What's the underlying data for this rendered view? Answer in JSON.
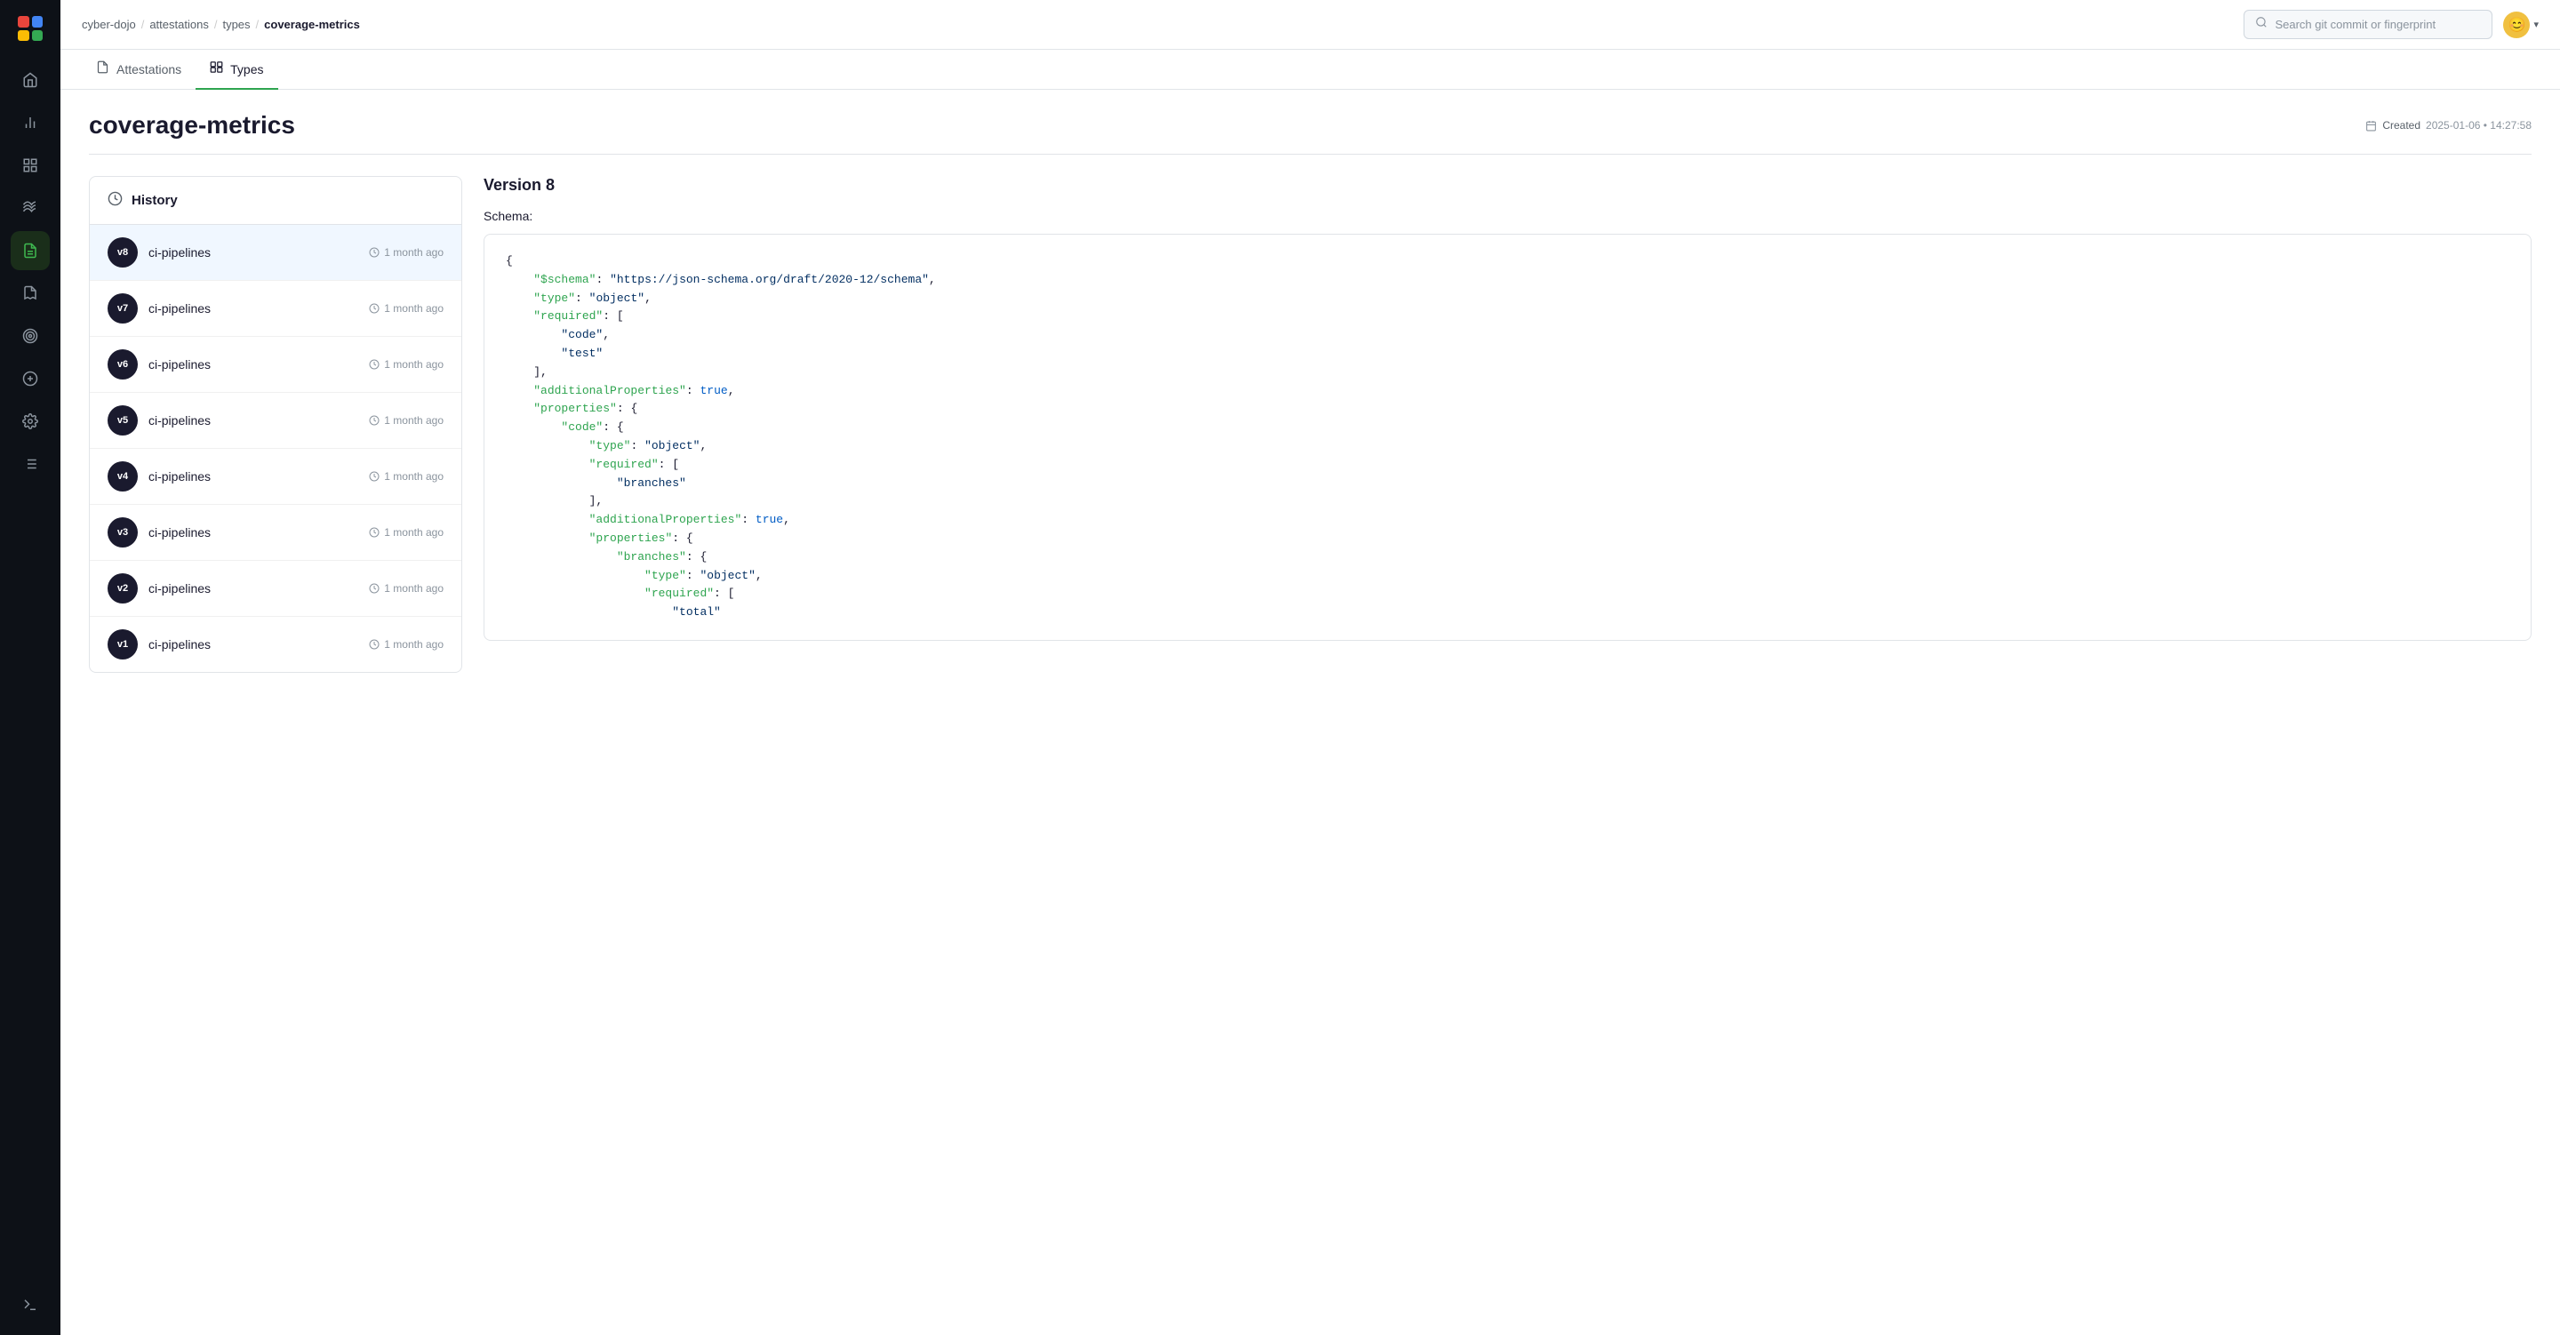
{
  "sidebar": {
    "logo_colors": [
      "red",
      "blue",
      "yellow",
      "green"
    ],
    "items": [
      {
        "name": "home",
        "icon": "⌂",
        "active": false
      },
      {
        "name": "chart-bar",
        "icon": "▦",
        "active": false
      },
      {
        "name": "grid",
        "icon": "⊞",
        "active": false
      },
      {
        "name": "waves",
        "icon": "≋",
        "active": false
      },
      {
        "name": "document",
        "icon": "📄",
        "active": true
      },
      {
        "name": "receipt",
        "icon": "🧾",
        "active": false
      },
      {
        "name": "target",
        "icon": "◎",
        "active": false
      },
      {
        "name": "plus-circle",
        "icon": "⊕",
        "active": false
      },
      {
        "name": "settings",
        "icon": "⚙",
        "active": false
      },
      {
        "name": "list",
        "icon": "☰",
        "active": false
      },
      {
        "name": "terminal",
        "icon": "›_",
        "active": false
      }
    ]
  },
  "header": {
    "breadcrumb": {
      "parts": [
        "cyber-dojo",
        "attestations",
        "types"
      ],
      "current": "coverage-metrics",
      "separator": "/"
    },
    "search": {
      "placeholder": "Search git commit or fingerprint"
    },
    "avatar": "😊"
  },
  "tabs": [
    {
      "label": "Attestations",
      "icon": "📋",
      "active": false
    },
    {
      "label": "Types",
      "icon": "🗂",
      "active": true
    }
  ],
  "page": {
    "title": "coverage-metrics",
    "created_label": "Created",
    "created_date": "2025-01-06 • 14:27:58"
  },
  "history": {
    "title": "History",
    "items": [
      {
        "version": "v8",
        "name": "ci-pipelines",
        "time": "1 month ago",
        "active": true
      },
      {
        "version": "v7",
        "name": "ci-pipelines",
        "time": "1 month ago",
        "active": false
      },
      {
        "version": "v6",
        "name": "ci-pipelines",
        "time": "1 month ago",
        "active": false
      },
      {
        "version": "v5",
        "name": "ci-pipelines",
        "time": "1 month ago",
        "active": false
      },
      {
        "version": "v4",
        "name": "ci-pipelines",
        "time": "1 month ago",
        "active": false
      },
      {
        "version": "v3",
        "name": "ci-pipelines",
        "time": "1 month ago",
        "active": false
      },
      {
        "version": "v2",
        "name": "ci-pipelines",
        "time": "1 month ago",
        "active": false
      },
      {
        "version": "v1",
        "name": "ci-pipelines",
        "time": "1 month ago",
        "active": false
      }
    ]
  },
  "schema_section": {
    "version_title": "Version 8",
    "schema_label": "Schema:"
  }
}
